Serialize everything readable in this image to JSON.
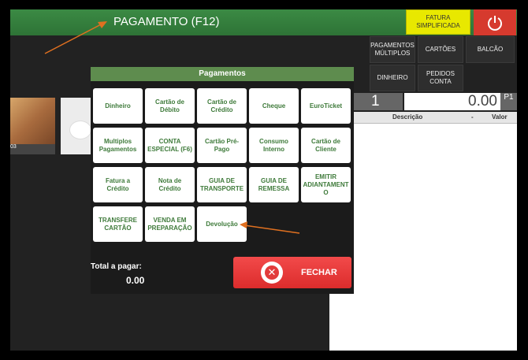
{
  "header": {
    "title": "PAGAMENTO (F12)",
    "fatura_label": "FATURA SIMPLIFICADA",
    "power_icon": "power-icon"
  },
  "right_buttons": {
    "pagamentos_multiplos": "PAGAMENTOS MÚLTIPLOS",
    "cartoes": "CARTÕES",
    "balcao": "BALCÃO",
    "dinheiro": "DINHEIRO",
    "pedidos_conta": "PEDIDOS CONTA"
  },
  "display": {
    "quantity": "1",
    "amount": "0.00",
    "price_level": "P1"
  },
  "table": {
    "columns": [
      "Descrição",
      "-",
      "Valor"
    ]
  },
  "products": {
    "first_caption": "03"
  },
  "dialog": {
    "title": "Pagamentos",
    "buttons": [
      "Dinheiro",
      "Cartão de Débito",
      "Cartão de Crédito",
      "Cheque",
      "EuroTicket",
      "Multiplos Pagamentos",
      "CONTA ESPECIAL (F6)",
      "Cartão Pré-Pago",
      "Consumo Interno",
      "Cartão de Cliente",
      "Fatura a Crédito",
      "Nota de Crédito",
      "GUIA DE TRANSPORTE",
      "GUIA DE REMESSA",
      "EMITIR ADIANTAMENT O",
      "TRANSFERE CARTÃO",
      "VENDA EM PREPARAÇÃO",
      "Devolução"
    ],
    "total_label": "Total a pagar:",
    "total_value": "0.00",
    "close_label": "FECHAR"
  },
  "colors": {
    "header_green": "#2e7336",
    "dialog_header": "#5e8c4e",
    "button_text_green": "#3e7a3a",
    "close_red": "#e23b3b",
    "fatura_yellow": "#e8e800",
    "annotation_arrow": "#e07020"
  }
}
